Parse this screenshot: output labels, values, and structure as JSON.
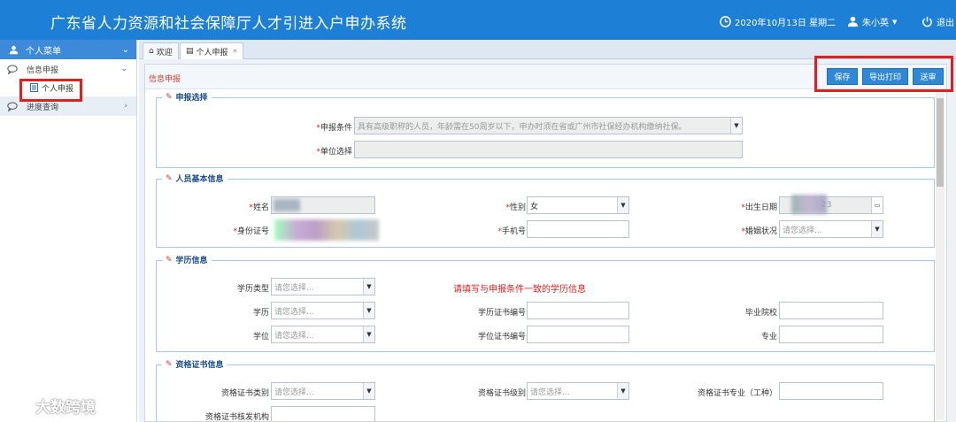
{
  "header": {
    "title": "广东省人力资源和社会保障厅人才引进入户申办系统",
    "date": "2020年10月13日 星期二",
    "user": "朱小英",
    "logout": "退出"
  },
  "sidebar": {
    "menu_title": "个人菜单",
    "group1": "信息申报",
    "item1": "个人申报",
    "group2": "进度查询"
  },
  "tabs": {
    "welcome": "欢迎",
    "personal": "个人申报"
  },
  "panel": {
    "title": "信息申报",
    "save": "保存",
    "export": "导出打印",
    "submit": "送审"
  },
  "sec1": {
    "title": "申报选择",
    "cond_label": "申报条件",
    "cond_value": "具有高级职称的人员，年龄需在50周岁以下，申办时须在省或广州市社保经办机构缴纳社保。",
    "unit_label": "单位选择"
  },
  "sec2": {
    "title": "人员基本信息",
    "name_label": "姓名",
    "gender_label": "性别",
    "gender_value": "女",
    "birth_label": "出生日期",
    "birth_partial": "23",
    "id_label": "身份证号",
    "phone_label": "手机号",
    "marital_label": "婚姻状况",
    "marital_value": "请您选择..."
  },
  "sec3": {
    "title": "学历信息",
    "type_label": "学历类型",
    "type_value": "请您选择...",
    "notice": "请填写与申报条件一致的学历信息",
    "edu_label": "学历",
    "edu_value": "请您选择...",
    "edu_cert_label": "学历证书编号",
    "school_label": "毕业院校",
    "degree_label": "学位",
    "degree_value": "请您选择...",
    "degree_cert_label": "学位证书编号",
    "major_label": "专业"
  },
  "sec4": {
    "title": "资格证书信息",
    "cat_label": "资格证书类别",
    "cat_value": "请您选择...",
    "level_label": "资格证书级别",
    "level_value": "请您选择...",
    "spec_label": "资格证书专业（工种）",
    "org_label": "资格证书核发机构"
  },
  "watermark": "大数跨境"
}
